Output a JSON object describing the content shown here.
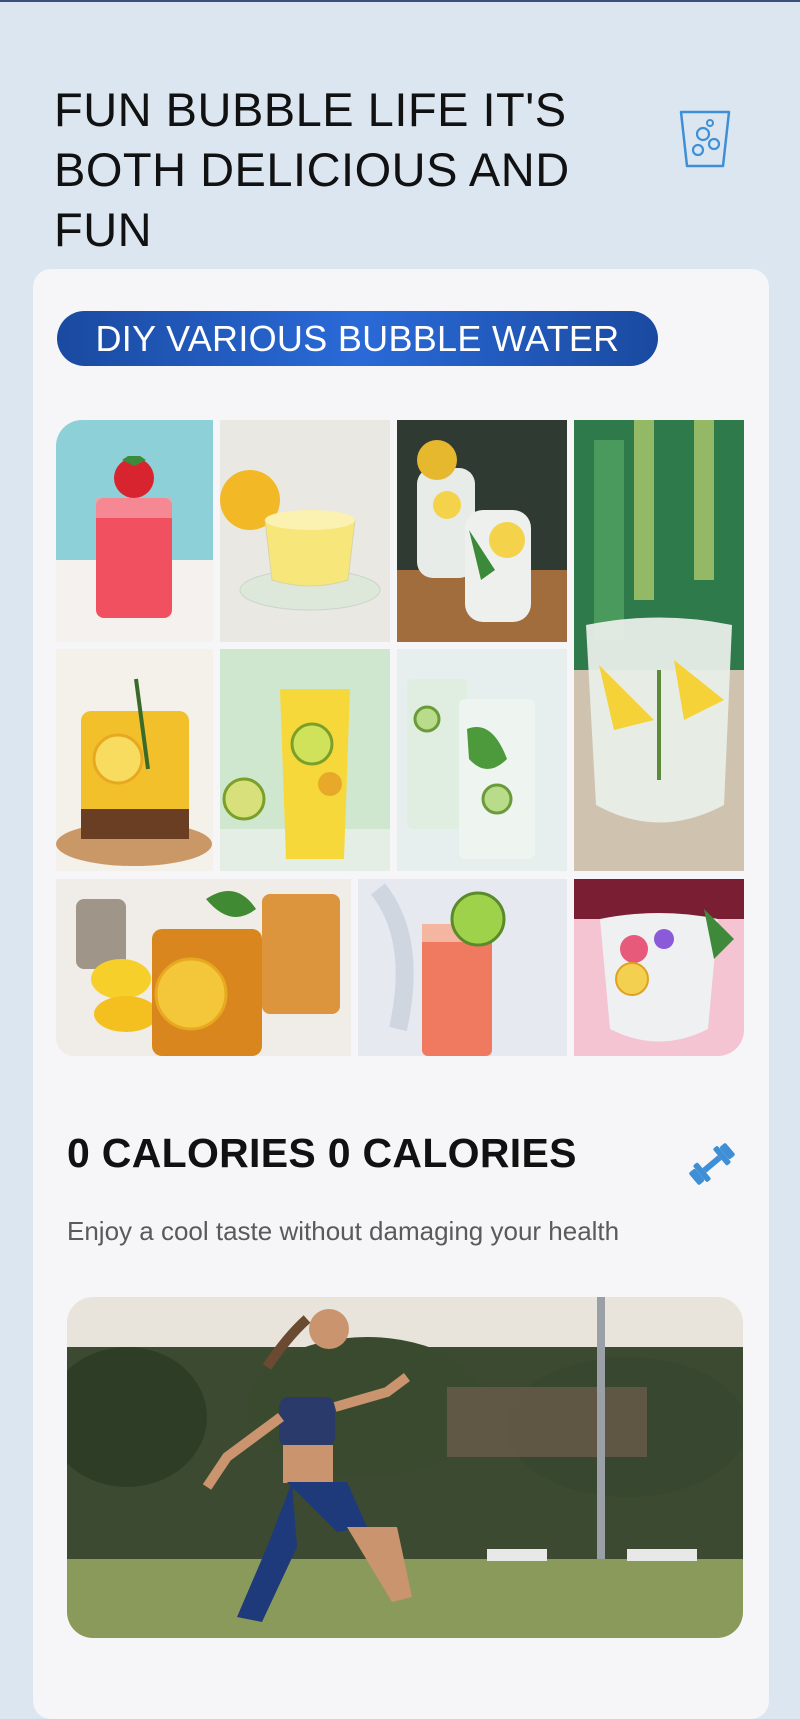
{
  "header": {
    "title_line1": "FUN BUBBLE LIFE IT'S",
    "title_line2": "BOTH DELICIOUS AND FUN",
    "icon": "glass-with-bubbles-icon"
  },
  "diy": {
    "banner_label": "DIY VARIOUS BUBBLE WATER",
    "gallery": [
      "strawberry-red-drink-photo",
      "lemon-tea-cup-photo",
      "mint-lemon-glasses-photo",
      "lemon-herb-tall-glass-photo",
      "rosemary-lemon-drink-photo",
      "lime-yellow-drink-photo",
      "cucumber-mint-water-photo",
      "iced-lemon-tea-photo",
      "pink-lime-soda-photo",
      "flower-ice-glass-photo"
    ]
  },
  "calories": {
    "title": "0 CALORIES 0 CALORIES",
    "subtitle": "Enjoy a cool taste without damaging your health",
    "icon": "dumbbell-icon",
    "image": "woman-running-photo"
  },
  "colors": {
    "page_bg": "#dce6f1",
    "card_bg": "#f6f6f8",
    "accent_blue": "#1a4aa0",
    "icon_blue": "#3f8fd6"
  }
}
